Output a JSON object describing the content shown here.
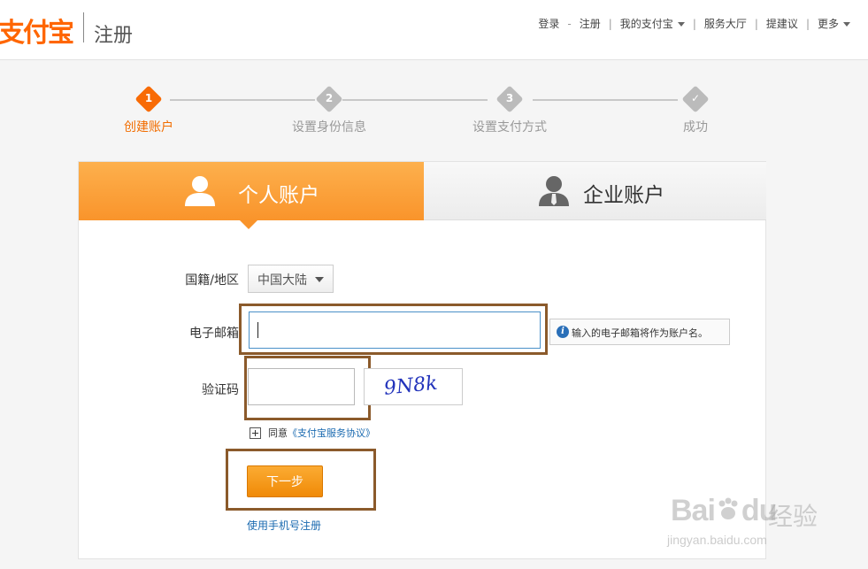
{
  "header": {
    "logo_text": "支付宝",
    "page_label": "注册",
    "nav": {
      "login": "登录",
      "dash": "-",
      "register": "注册",
      "my_alipay": "我的支付宝",
      "service_hall": "服务大厅",
      "suggest": "提建议",
      "more": "更多"
    }
  },
  "steps": [
    {
      "num": "1",
      "label": "创建账户",
      "state": "active"
    },
    {
      "num": "2",
      "label": "设置身份信息",
      "state": "pending"
    },
    {
      "num": "3",
      "label": "设置支付方式",
      "state": "pending"
    },
    {
      "num": "✓",
      "label": "成功",
      "state": "pending"
    }
  ],
  "tabs": {
    "personal": "个人账户",
    "company": "企业账户"
  },
  "form": {
    "nationality_label": "国籍/地区",
    "nationality_value": "中国大陆",
    "email_label": "电子邮箱",
    "email_value": "",
    "email_hint_icon": "i",
    "email_hint": "输入的电子邮箱将作为账户名。",
    "captcha_label": "验证码",
    "captcha_value": "",
    "captcha_text": "9N8k",
    "agree_prefix": "同意",
    "agree_link": "《支付宝服务协议》",
    "next_button": "下一步",
    "mobile_register": "使用手机号注册"
  },
  "watermark": {
    "brand": "Bai",
    "brand2": "du",
    "cn": "经验",
    "url": "jingyan.baidu.com"
  },
  "colors": {
    "accent": "#f86b05",
    "tab_orange": "#f9942b",
    "link": "#1a6ab0",
    "highlight": "#8b5a2b"
  }
}
